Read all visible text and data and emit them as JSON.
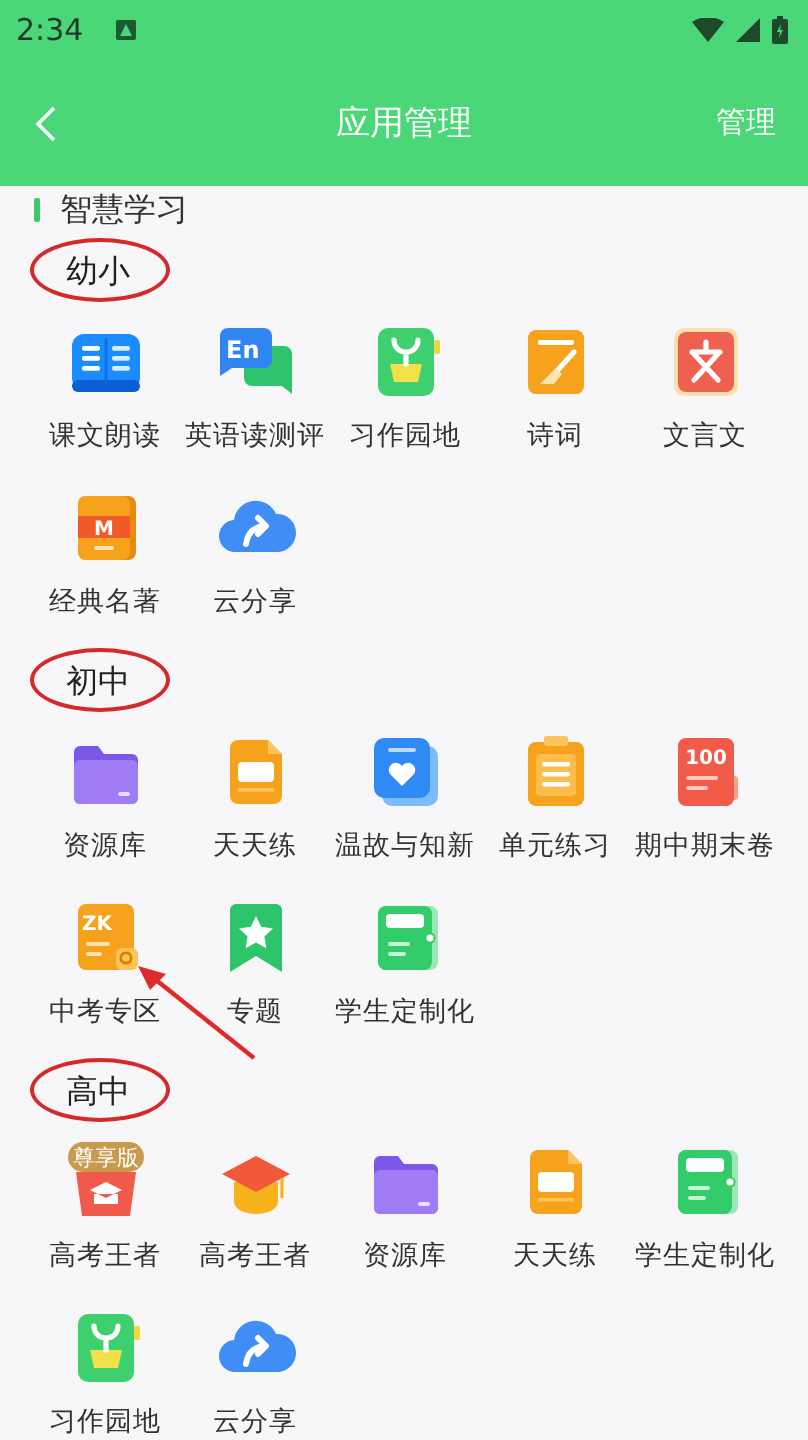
{
  "status_bar": {
    "time": "2:34"
  },
  "header": {
    "title": "应用管理",
    "action": "管理"
  },
  "category": {
    "title": "智慧学习"
  },
  "sections": [
    {
      "title": "幼小",
      "circled": true,
      "apps": [
        {
          "label": "课文朗读",
          "kind": "book",
          "arrowed": false
        },
        {
          "label": "英语读测评",
          "kind": "chat",
          "icon_text": "En",
          "arrowed": false
        },
        {
          "label": "习作园地",
          "kind": "plant",
          "arrowed": false
        },
        {
          "label": "诗词",
          "kind": "brush",
          "arrowed": false
        },
        {
          "label": "文言文",
          "kind": "seal",
          "arrowed": false
        },
        {
          "label": "经典名著",
          "kind": "classic",
          "icon_text": "M",
          "arrowed": false
        },
        {
          "label": "云分享",
          "kind": "cloud",
          "arrowed": false
        }
      ]
    },
    {
      "title": "初中",
      "circled": true,
      "apps": [
        {
          "label": "资源库",
          "kind": "folder",
          "arrowed": false
        },
        {
          "label": "天天练",
          "kind": "doc",
          "arrowed": false
        },
        {
          "label": "温故与知新",
          "kind": "heart",
          "arrowed": false
        },
        {
          "label": "单元练习",
          "kind": "clipboard",
          "arrowed": false
        },
        {
          "label": "期中期末卷",
          "kind": "score",
          "icon_text": "100",
          "arrowed": false
        },
        {
          "label": "中考专区",
          "kind": "zk",
          "icon_text": "ZK",
          "arrowed": true
        },
        {
          "label": "专题",
          "kind": "star",
          "arrowed": false
        },
        {
          "label": "学生定制化",
          "kind": "wallet",
          "arrowed": false
        }
      ]
    },
    {
      "title": "高中",
      "circled": true,
      "apps": [
        {
          "label": "高考王者",
          "kind": "crown",
          "icon_text": "尊享版",
          "arrowed": false
        },
        {
          "label": "高考王者",
          "kind": "cap",
          "arrowed": false
        },
        {
          "label": "资源库",
          "kind": "folder",
          "arrowed": false
        },
        {
          "label": "天天练",
          "kind": "doc",
          "arrowed": false
        },
        {
          "label": "学生定制化",
          "kind": "wallet",
          "arrowed": false
        },
        {
          "label": "习作园地",
          "kind": "plant",
          "arrowed": false
        },
        {
          "label": "云分享",
          "kind": "cloud",
          "arrowed": false
        }
      ]
    }
  ]
}
